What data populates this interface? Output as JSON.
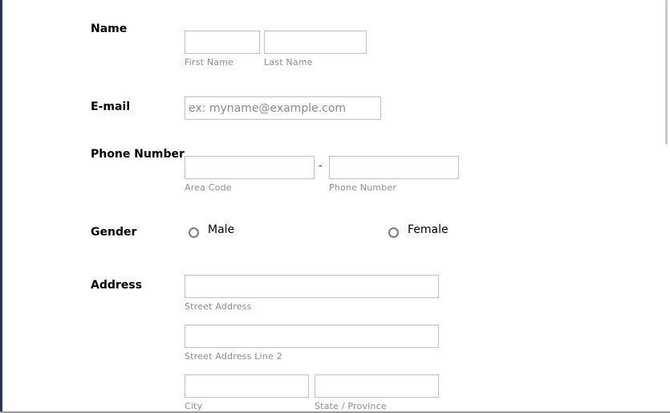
{
  "form": {
    "name": {
      "label": "Name",
      "first_sublabel": "First Name",
      "last_sublabel": "Last Name",
      "first_value": "",
      "last_value": ""
    },
    "email": {
      "label": "E-mail",
      "placeholder": "ex: myname@example.com",
      "value": ""
    },
    "phone": {
      "label": "Phone Number",
      "separator": "-",
      "area_sublabel": "Area Code",
      "number_sublabel": "Phone Number",
      "area_value": "",
      "number_value": ""
    },
    "gender": {
      "label": "Gender",
      "options": [
        "Male",
        "Female"
      ],
      "selected": ""
    },
    "address": {
      "label": "Address",
      "street_sublabel": "Street Address",
      "street2_sublabel": "Street Address Line 2",
      "city_sublabel": "City",
      "state_sublabel": "State / Province",
      "street_value": "",
      "street2_value": "",
      "city_value": "",
      "state_value": ""
    }
  }
}
